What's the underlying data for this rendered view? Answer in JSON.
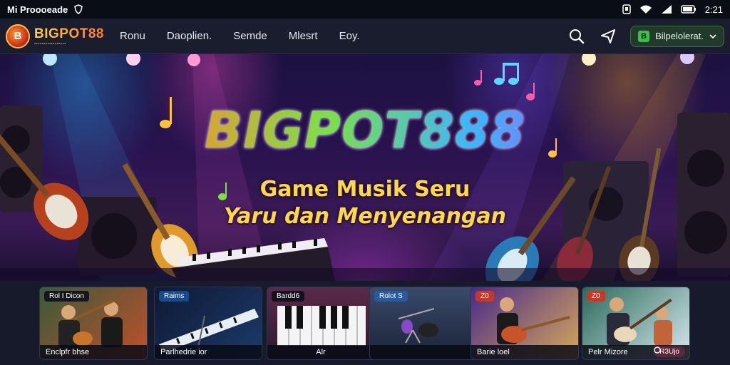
{
  "status": {
    "left_text": "Mi Proooeade",
    "time": "2:21"
  },
  "nav": {
    "logo_text": "BIGPOT88",
    "links": [
      "Ronu",
      "Daoplien.",
      "Semde",
      "Mlesrt",
      "Eoy."
    ],
    "cta_label": "Bilpelolerat.",
    "cta_icon": "B"
  },
  "hero": {
    "title": "BIGPOT888",
    "subtitle_line1": "Game Musik Seru",
    "subtitle_line2": "Yaru dan Menyenangan"
  },
  "tiles": [
    {
      "tag": "Rol I Dicon",
      "caption": "Enclpfr bhse"
    },
    {
      "tag": "Raims",
      "caption": "Parlhedrie ior"
    },
    {
      "tag": "Bardd6",
      "caption": "Alr"
    },
    {
      "tag": "Rolot S",
      "caption": ""
    },
    {
      "tag": "Z0",
      "caption": "Barie loel"
    },
    {
      "tag": "Z0",
      "caption": "Pelr Mizore",
      "badge": "R3Ujo"
    }
  ],
  "colors": {
    "brand_gold": "#ffd24a",
    "cta_green": "#3fbf4a",
    "background": "#0d1020"
  }
}
